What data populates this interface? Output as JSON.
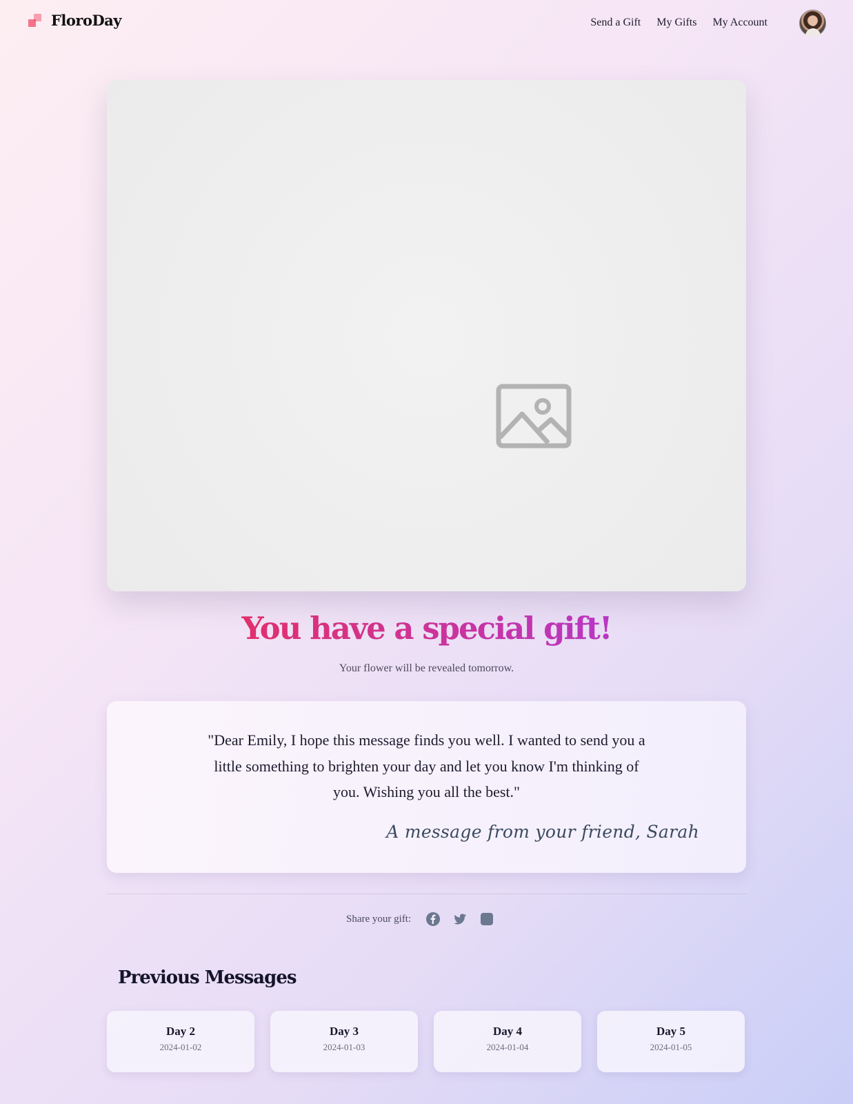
{
  "brand": {
    "name": "FloroDay",
    "accent": "#f4738b"
  },
  "nav": {
    "items": [
      {
        "label": "Send a Gift"
      },
      {
        "label": "My Gifts"
      },
      {
        "label": "My Account"
      }
    ],
    "avatar_icon": "user-avatar"
  },
  "gift": {
    "image_icon": "image-placeholder-icon",
    "title": "You have a special gift!",
    "title_gradient": [
      "#e1306c",
      "#b837c4"
    ],
    "subtitle": "Your flower will be revealed tomorrow."
  },
  "message": {
    "text": "\"Dear Emily, I hope this message finds you well. I wanted to send you a little something to brighten your day and let you know I'm thinking of you. Wishing you all the best.\"",
    "signature": "A message from your friend, Sarah"
  },
  "share": {
    "label": "Share your gift:",
    "icons": [
      "facebook-icon",
      "twitter-icon",
      "instagram-icon"
    ],
    "icon_color": "#6b7890"
  },
  "previous": {
    "title": "Previous Messages",
    "items": [
      {
        "day": "Day 2",
        "date": "2024-01-02"
      },
      {
        "day": "Day 3",
        "date": "2024-01-03"
      },
      {
        "day": "Day 4",
        "date": "2024-01-04"
      },
      {
        "day": "Day 5",
        "date": "2024-01-05"
      }
    ]
  }
}
